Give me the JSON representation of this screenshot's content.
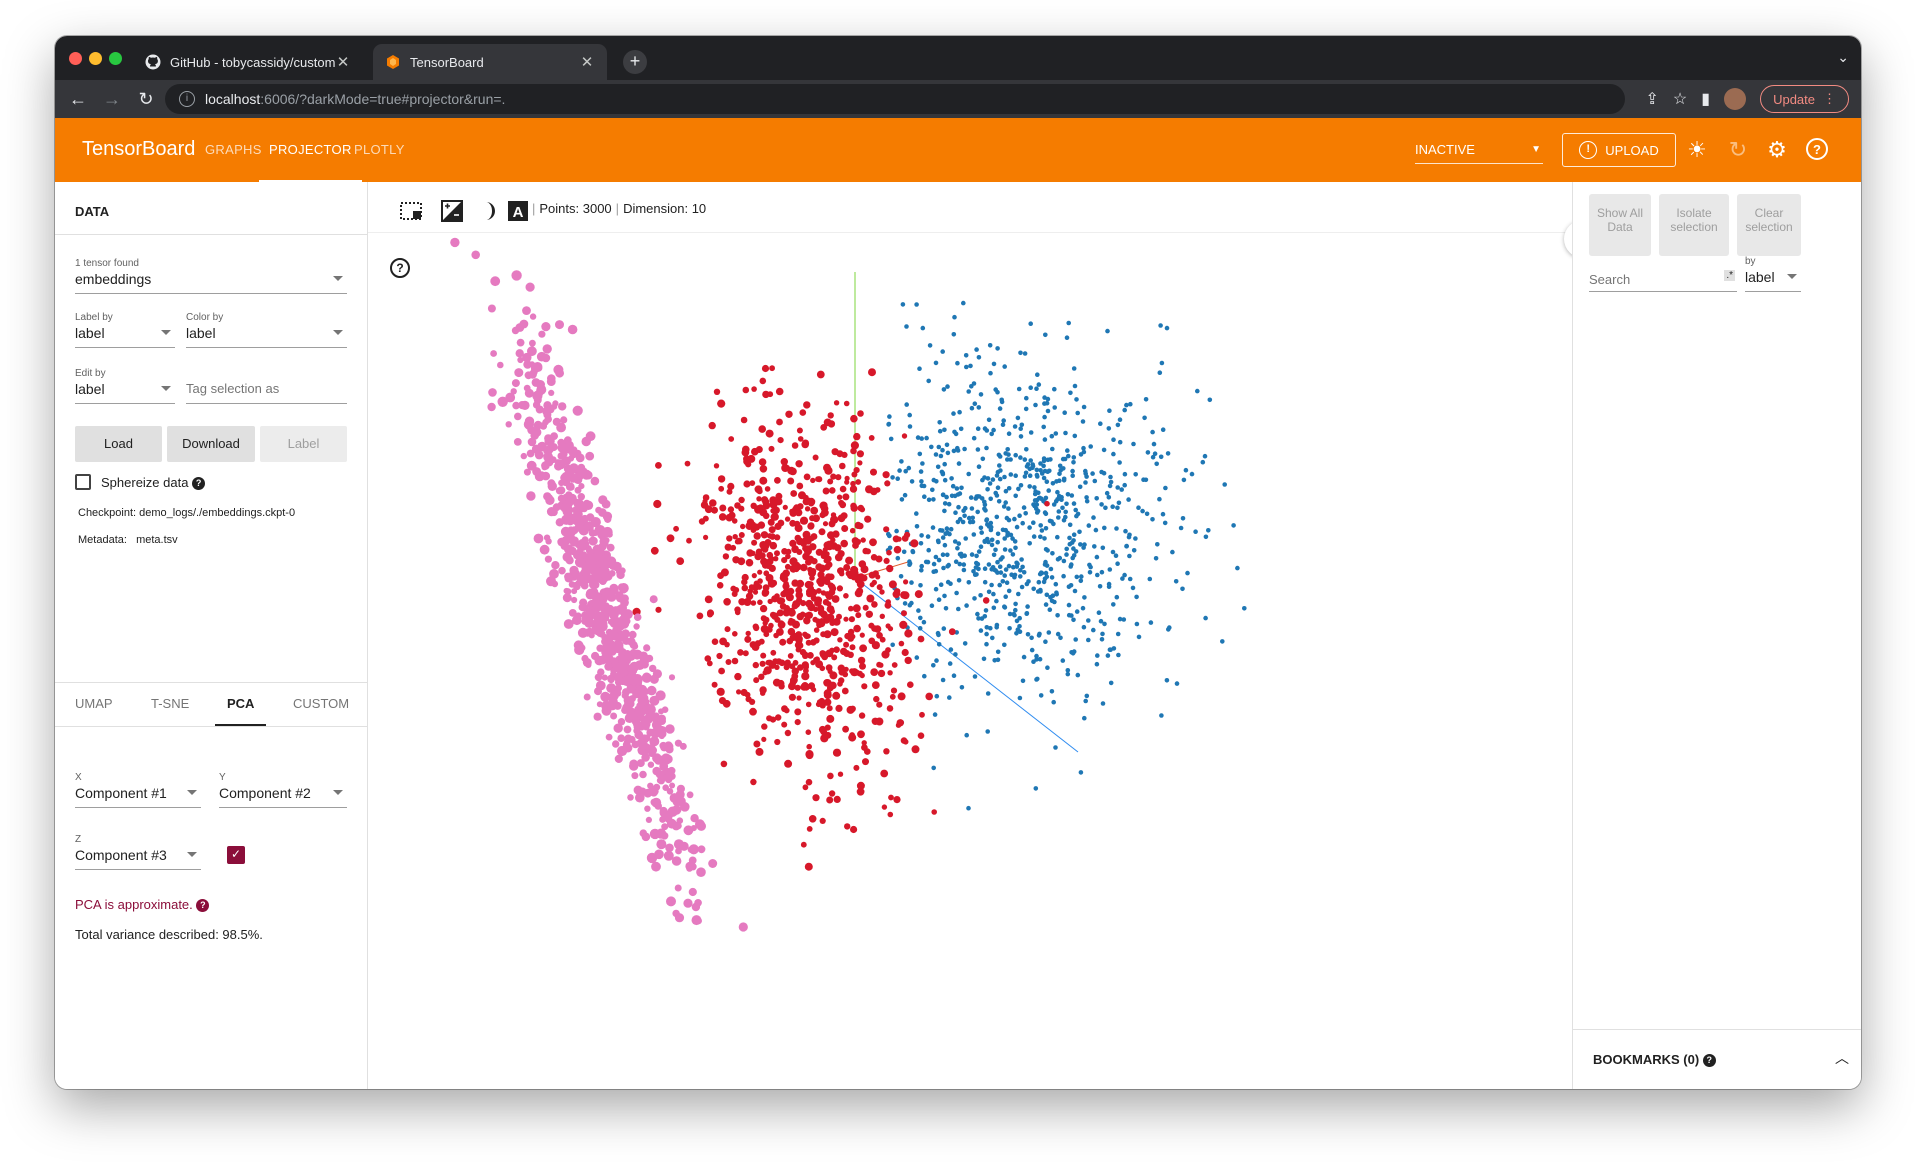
{
  "browser": {
    "tabs": [
      {
        "title": "GitHub - tobycassidy/custom_",
        "active": false
      },
      {
        "title": "TensorBoard",
        "active": true
      }
    ],
    "url_host": "localhost",
    "url_rest": ":6006/?darkMode=true#projector&run=.",
    "update_label": "Update"
  },
  "header": {
    "brand": "TensorBoard",
    "nav": [
      "GRAPHS",
      "PROJECTOR",
      "PLOTLY"
    ],
    "active_nav": "PROJECTOR",
    "run_select": "INACTIVE",
    "upload_label": "UPLOAD",
    "accent": "#f57c00"
  },
  "left": {
    "title": "DATA",
    "tensor_label": "1 tensor found",
    "tensor_value": "embeddings",
    "label_by_label": "Label by",
    "label_by_value": "label",
    "color_by_label": "Color by",
    "color_by_value": "label",
    "edit_by_label": "Edit by",
    "edit_by_value": "label",
    "tag_placeholder": "Tag selection as",
    "load_label": "Load",
    "download_label": "Download",
    "label_btn": "Label",
    "sphereize_label": "Sphereize data",
    "checkpoint_label": "Checkpoint:",
    "checkpoint_value": "demo_logs/./embeddings.ckpt-0",
    "metadata_label": "Metadata:",
    "metadata_value": "meta.tsv",
    "projection_tabs": [
      "UMAP",
      "T-SNE",
      "PCA",
      "CUSTOM"
    ],
    "active_projection": "PCA",
    "x_label": "X",
    "x_value": "Component #1",
    "y_label": "Y",
    "y_value": "Component #2",
    "z_label": "Z",
    "z_value": "Component #3",
    "z_enabled": true,
    "pca_note": "PCA is approximate.",
    "variance": "Total variance described: 98.5%."
  },
  "main": {
    "points_text": "Points: 3000",
    "dimension_text": "Dimension: 10",
    "clusters": [
      {
        "name": "pink",
        "color": "#e57ac0"
      },
      {
        "name": "red",
        "color": "#d7182a"
      },
      {
        "name": "blue",
        "color": "#1f77b4"
      }
    ]
  },
  "right": {
    "show_all": "Show All Data",
    "isolate": "Isolate selection",
    "clear": "Clear selection",
    "search_placeholder": "Search",
    "search_regex": ".*",
    "by_label": "by",
    "by_value": "label",
    "bookmarks": "BOOKMARKS (0)"
  }
}
